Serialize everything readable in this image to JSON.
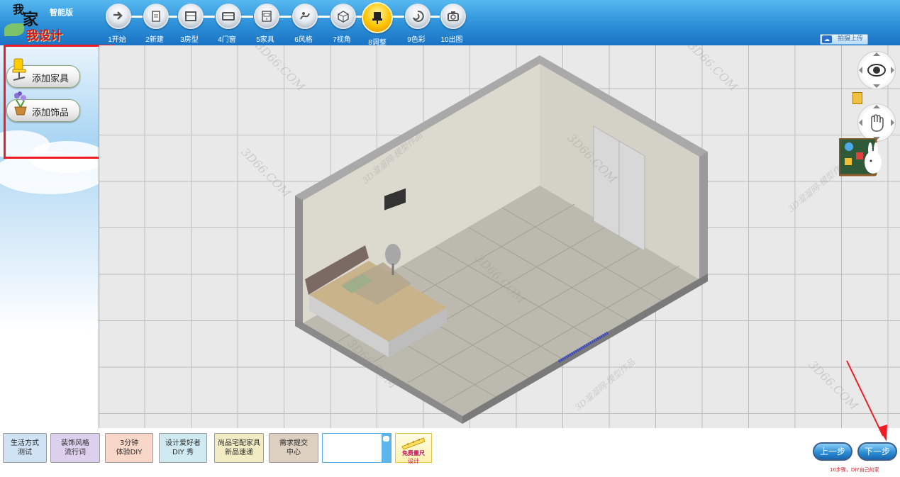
{
  "logo": {
    "line1": "我",
    "line2": "家",
    "line3": "我设计",
    "edition": "智能版"
  },
  "steps": [
    {
      "label": "1开始",
      "icon": "arrow-right-icon"
    },
    {
      "label": "2新建",
      "icon": "new-page-icon"
    },
    {
      "label": "3房型",
      "icon": "room-layout-icon"
    },
    {
      "label": "4门窗",
      "icon": "window-icon"
    },
    {
      "label": "5家具",
      "icon": "furniture-icon"
    },
    {
      "label": "6风格",
      "icon": "style-icon"
    },
    {
      "label": "7视角",
      "icon": "cube-view-icon"
    },
    {
      "label": "8调整",
      "icon": "chair-adjust-icon",
      "active": true
    },
    {
      "label": "9色彩",
      "icon": "color-swirl-icon"
    },
    {
      "label": "10出图",
      "icon": "camera-icon"
    }
  ],
  "toolbar": {
    "upload_label": "拍摄上传"
  },
  "sidebar": {
    "add_furniture": "添加家具",
    "add_decor": "添加饰品"
  },
  "canvas": {
    "watermark": "3D66.COM",
    "watermark_cn": "3D溜溜网-模型作品"
  },
  "bottom": {
    "buttons": [
      {
        "line1": "生活方式",
        "line2": "测试",
        "color": "#cfe3f5"
      },
      {
        "line1": "装饰风格",
        "line2": "流行词",
        "color": "#ddd0ee"
      },
      {
        "line1": "3分钟",
        "line2": "体验DIY",
        "color": "#f9d7c8"
      },
      {
        "line1": "设计爱好者",
        "line2": "DIY 秀",
        "color": "#cfeaf0"
      },
      {
        "line1": "尚品宅配家具",
        "line2": "新品速递",
        "color": "#f1ecc4"
      },
      {
        "line1": "需求提交",
        "line2": "中心",
        "color": "#ddd0c0"
      }
    ],
    "free_measure_line1": "免费量尺",
    "free_measure_line2": "设计",
    "prev": "上一步",
    "next": "下一步",
    "hint": "10步骤，DIY自己的家"
  },
  "colors": {
    "accent_red": "#ee1c25",
    "topbar": "#2d8fd8"
  }
}
